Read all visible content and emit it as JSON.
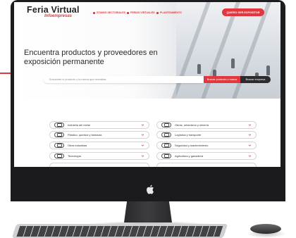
{
  "site": {
    "logo_title": "Feria Virtual",
    "logo_sub": "Infoempresas",
    "nav": [
      "STANDS SECTORIALES",
      "FERIAS VIRTUALES",
      "PLANTEAMIENTO"
    ],
    "exhibit_button": "QUIERO SER EXPOSITOR",
    "headline": "Encuentra productos y proveedores en exposición permanente",
    "search_placeholder": "Encuentre el producto o la marca que necesitas",
    "btn_products": "Buscar producto o marca",
    "btn_companies": "Buscar empresa"
  },
  "categories": [
    {
      "label": "Industria del metal",
      "icon": "gear-icon"
    },
    {
      "label": "Obras, urbanismo y minería",
      "icon": "excavator-icon"
    },
    {
      "label": "Plástico, química y farmacia",
      "icon": "flask-icon"
    },
    {
      "label": "Logística y transporte",
      "icon": "truck-icon"
    },
    {
      "label": "Otras industrias",
      "icon": "factory-icon"
    },
    {
      "label": "Seguridad y mantenimiento",
      "icon": "helmet-icon"
    },
    {
      "label": "Tecnología",
      "icon": "chip-icon"
    },
    {
      "label": "Agricultura y ganadería",
      "icon": "tractor-icon"
    }
  ],
  "colors": {
    "accent": "#e0383e",
    "dark": "#2c2c2e"
  }
}
